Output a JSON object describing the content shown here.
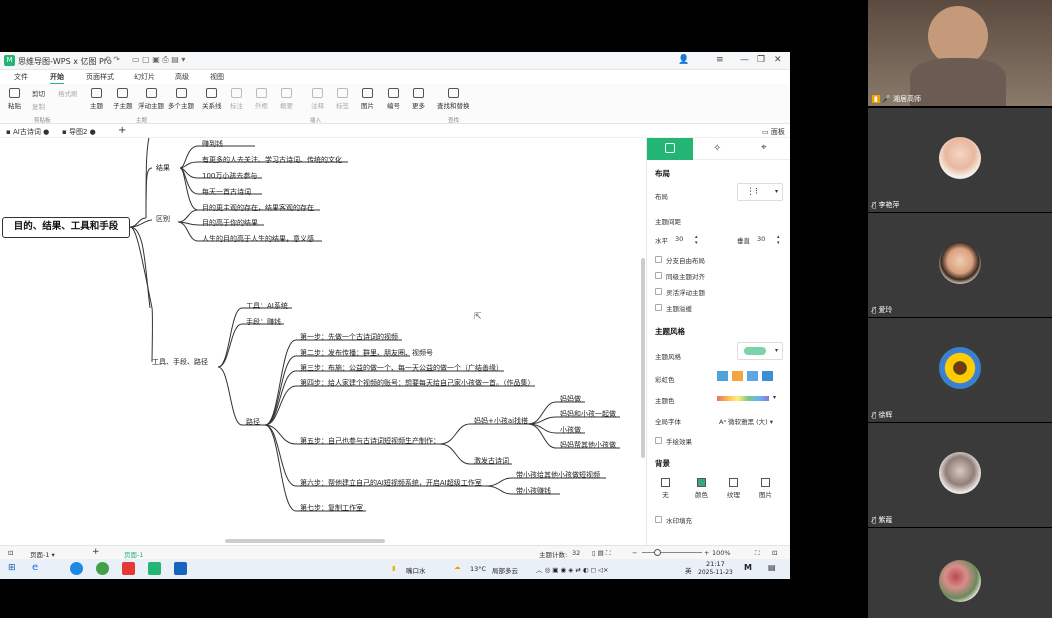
{
  "app": {
    "title": "思维导图-WPS x 亿图 Pro",
    "menu": [
      "文件",
      "开始",
      "页面样式",
      "幻灯片",
      "高级",
      "视图"
    ],
    "active_menu": "开始",
    "ribbon": {
      "paste": "粘贴",
      "cut": "剪切",
      "copy": "复制",
      "format_painter": "格式刷",
      "topic": "主题",
      "subtopic": "子主题",
      "floating_topic": "浮动主题",
      "multi_topic": "多个主题",
      "relation": "关系线",
      "callout": "标注",
      "boundary": "外框",
      "summary": "概要",
      "note": "注释",
      "mark": "标签",
      "picture": "图片",
      "number": "编号",
      "more": "更多",
      "find_replace": "查找和替换",
      "group_clipboard": "剪贴板",
      "group_topic": "主题",
      "group_insert": "插入",
      "group_find": "查找"
    },
    "tabs": [
      "AI古诗词",
      "导图2"
    ],
    "panel_toggle": "面板"
  },
  "mindmap": {
    "root": "目的、结果、工具和手段",
    "b1": "结果",
    "b1_items": [
      "赚到钱",
      "有更多的人去关注、学习古诗词、传统的文化",
      "100万小孩去参与",
      "每天一首古诗词"
    ],
    "b2": "区别",
    "b2_items": [
      "目的更主观的存在，结果客观的存在",
      "目的高于你的结果",
      "人生的目的高于人生的结果，意义感"
    ],
    "b3": "工具、手段、路径",
    "tool": "工具：AI系统",
    "means": "手段：赚钱",
    "path": "路径",
    "steps": [
      "第一步：先做一个古诗词的视频",
      "第二步：发布传播：群里、朋友圈、视频号",
      "第三步：布施：公益的做一个、每一天公益的做一个（广结善缘）",
      "第四步：给人家建个视频的账号：想要每天给自己家小孩做一首。（作品集）",
      "第五步：自己也参与古诗词短视频生产制作：",
      "第六步：帮他建立自己的AI短视频系统，开启AI超级工作室",
      "第七步：复制工作室"
    ],
    "step5_children": [
      "妈妈+小孩ai找搭",
      "激发古诗词"
    ],
    "step5_leaf": [
      "妈妈做",
      "妈妈和小孩一起做",
      "小孩做",
      "妈妈帮其他小孩做"
    ],
    "step6_children": [
      "带小孩给其他小孩做短视频",
      "带小孩赚钱"
    ]
  },
  "panel": {
    "layout_header": "布局",
    "layout": "布局",
    "spacing": "主题间距",
    "horizontal": "水平",
    "horizontal_value": "30",
    "vertical": "垂直",
    "vertical_value": "30",
    "options": [
      "分支自由布局",
      "同级主题对齐",
      "灵活浮动主题",
      "主题溢缓"
    ],
    "style_header": "主题风格",
    "theme_style": "主题风格",
    "color_scheme": "彩虹色",
    "theme_color": "主题色",
    "global_font": "全局字体",
    "font_value": "微软雅黑 (大)",
    "hand_drawn": "手绘效果",
    "bg_header": "背景",
    "bg_options": [
      "无",
      "颜色",
      "纹理",
      "图片"
    ],
    "watermark": "水印填充"
  },
  "status": {
    "page_left": "页面-1",
    "page_tab": "页面-1",
    "topic_count_label": "主题计数:",
    "topic_count": "32",
    "zoom": "100%"
  },
  "taskbar": {
    "weather_app": "嘴口水",
    "temp": "13°C",
    "weather": "局部多云",
    "lang": "英",
    "time": "21:17",
    "date": "2025-11-23"
  },
  "participants": [
    {
      "name": "湘居高师",
      "muted": false
    },
    {
      "name": "李艳萍",
      "muted": true
    },
    {
      "name": "爱玲",
      "muted": true
    },
    {
      "name": "徐辉",
      "muted": true
    },
    {
      "name": "紫蔻",
      "muted": true
    }
  ],
  "colors": {
    "accent": "#22b573",
    "taskbar": "#eaf0f8"
  }
}
